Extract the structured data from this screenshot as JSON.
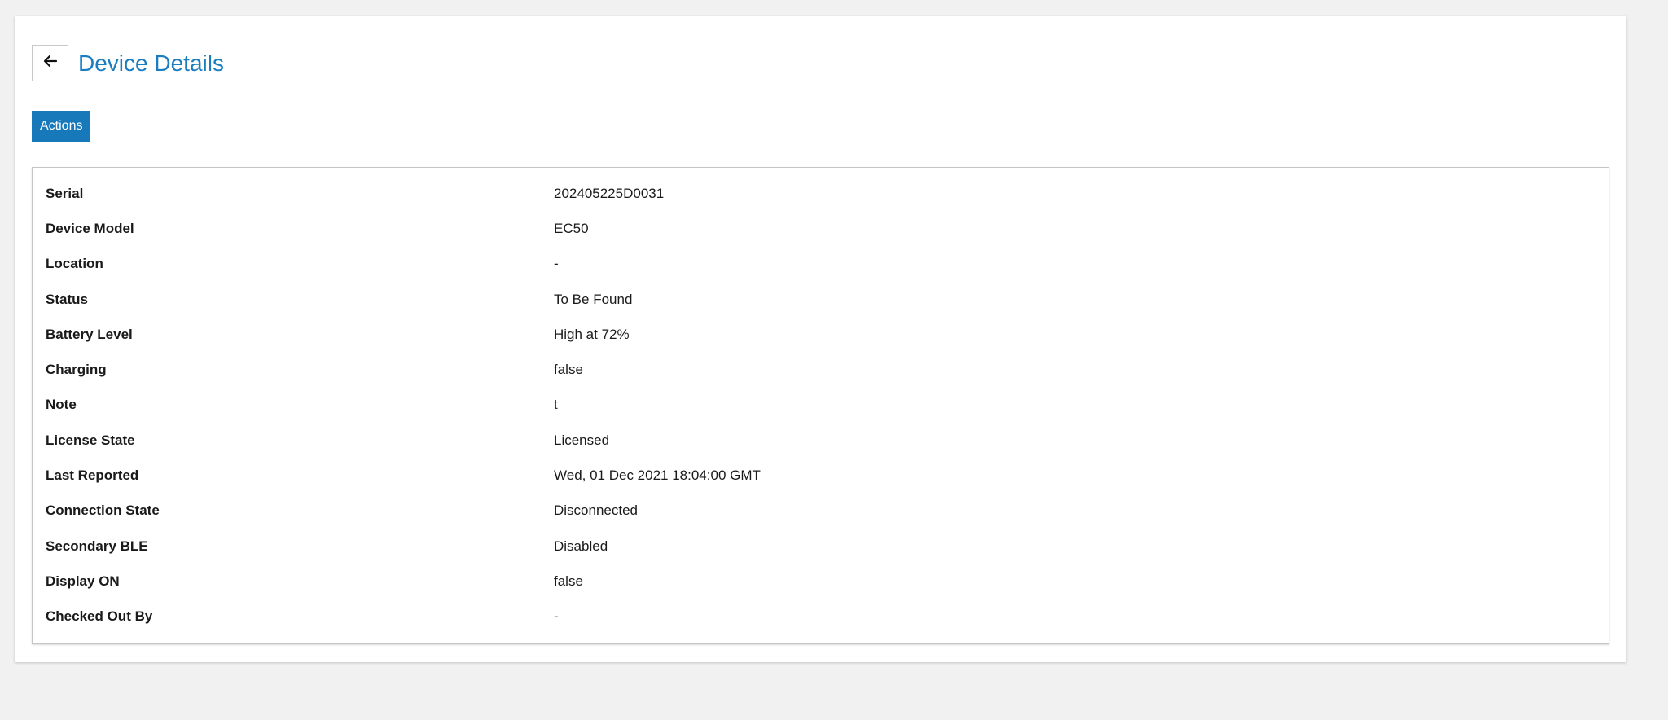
{
  "header": {
    "title": "Device Details",
    "back_icon": "arrow-left-icon"
  },
  "toolbar": {
    "actions_label": "Actions"
  },
  "colors": {
    "accent": "#1779ba",
    "title": "#1a7dbf",
    "background": "#f1f1f1"
  },
  "details": [
    {
      "label": "Serial",
      "value": "202405225D0031"
    },
    {
      "label": "Device Model",
      "value": "EC50"
    },
    {
      "label": "Location",
      "value": "-"
    },
    {
      "label": "Status",
      "value": "To Be Found"
    },
    {
      "label": "Battery Level",
      "value": "High at 72%"
    },
    {
      "label": "Charging",
      "value": "false"
    },
    {
      "label": "Note",
      "value": "t"
    },
    {
      "label": "License State",
      "value": "Licensed"
    },
    {
      "label": "Last Reported",
      "value": "Wed, 01 Dec 2021 18:04:00 GMT"
    },
    {
      "label": "Connection State",
      "value": "Disconnected"
    },
    {
      "label": "Secondary BLE",
      "value": "Disabled"
    },
    {
      "label": "Display ON",
      "value": "false"
    },
    {
      "label": "Checked Out By",
      "value": "-"
    }
  ]
}
